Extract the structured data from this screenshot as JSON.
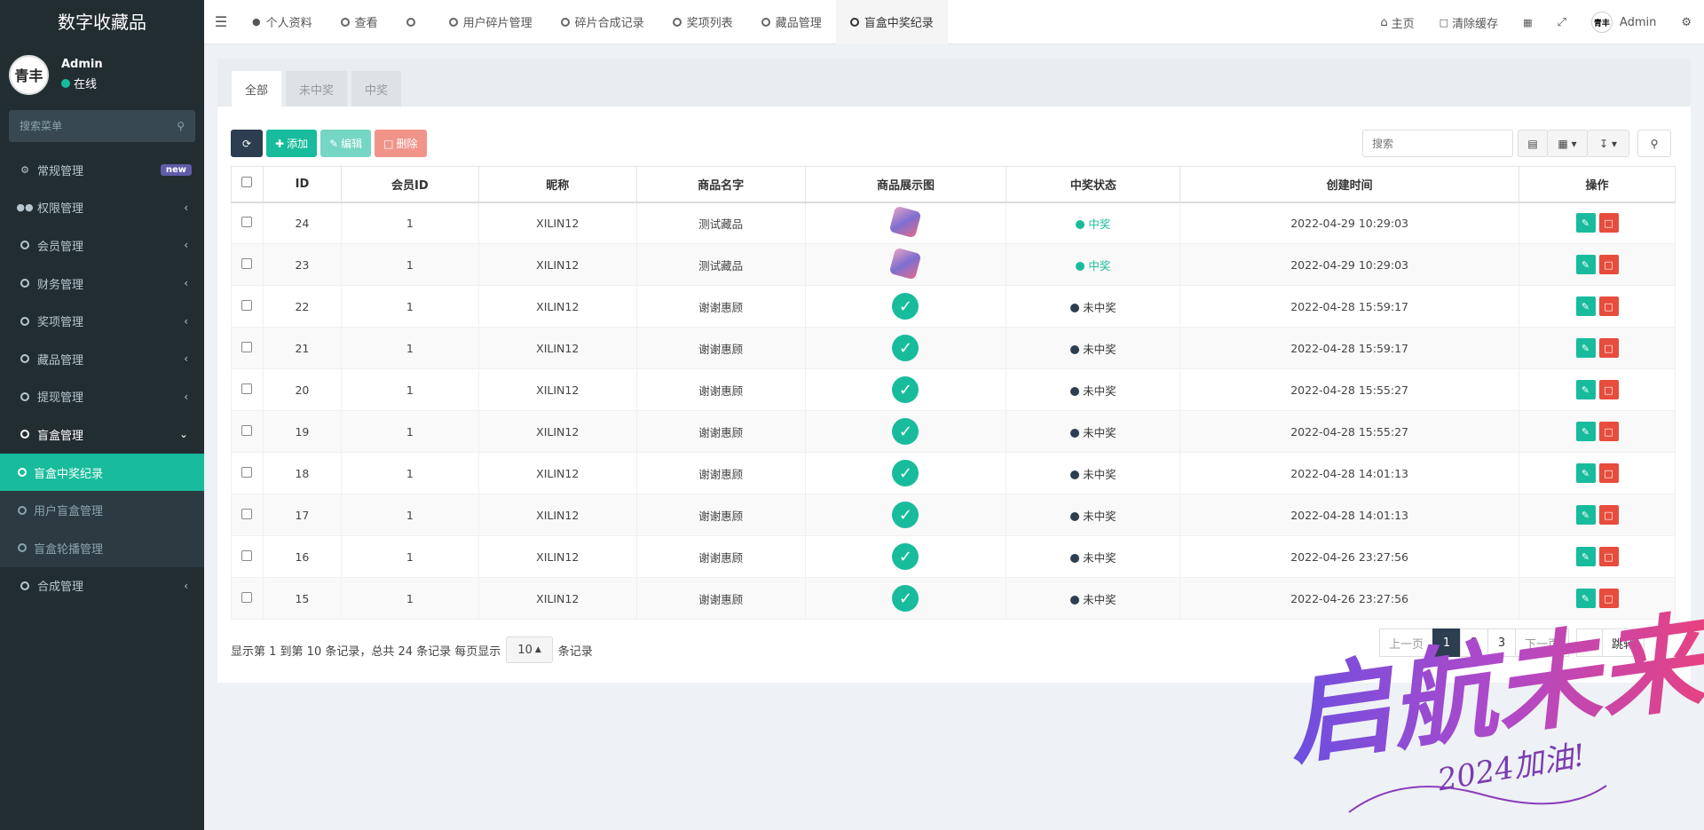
{
  "sidebar": {
    "brand": "数字收藏品",
    "user": {
      "name": "Admin",
      "status": "在线",
      "avatar_text": "青丰"
    },
    "search_placeholder": "搜索菜单",
    "items": [
      {
        "label": "常规管理",
        "icon": "cogs-icon",
        "badge": "new"
      },
      {
        "label": "权限管理",
        "icon": "users-icon"
      },
      {
        "label": "会员管理",
        "icon": "circle-icon"
      },
      {
        "label": "财务管理",
        "icon": "circle-icon"
      },
      {
        "label": "奖项管理",
        "icon": "circle-icon"
      },
      {
        "label": "藏品管理",
        "icon": "circle-icon"
      },
      {
        "label": "提现管理",
        "icon": "circle-icon"
      },
      {
        "label": "盲盒管理",
        "icon": "circle-icon",
        "open": true
      }
    ],
    "subitems": [
      {
        "label": "盲盒中奖纪录",
        "active": true
      },
      {
        "label": "用户盲盒管理"
      },
      {
        "label": "盲盒轮播管理"
      }
    ],
    "last_item": {
      "label": "合成管理"
    }
  },
  "topbar": {
    "tabs": [
      {
        "label": "个人资料",
        "icon": "user-icon"
      },
      {
        "label": "查看"
      },
      {
        "label": ""
      },
      {
        "label": "用户碎片管理"
      },
      {
        "label": "碎片合成记录"
      },
      {
        "label": "奖项列表"
      },
      {
        "label": "藏品管理"
      },
      {
        "label": "盲盒中奖纪录",
        "active": true
      }
    ],
    "right": {
      "home": "主页",
      "clear_cache": "清除缓存",
      "user": "Admin"
    }
  },
  "panel": {
    "tabs": [
      "全部",
      "未中奖",
      "中奖"
    ],
    "toolbar": {
      "add": "添加",
      "edit": "编辑",
      "delete": "删除"
    },
    "search_placeholder": "搜索"
  },
  "table": {
    "headers": [
      "ID",
      "会员ID",
      "昵称",
      "商品名字",
      "商品展示图",
      "中奖状态",
      "创建时间",
      "操作"
    ],
    "rows": [
      {
        "id": "24",
        "member_id": "1",
        "nickname": "XILIN12",
        "product": "测试藏品",
        "image": "gem",
        "status": "中奖",
        "win": true,
        "created": "2022-04-29 10:29:03"
      },
      {
        "id": "23",
        "member_id": "1",
        "nickname": "XILIN12",
        "product": "测试藏品",
        "image": "gem",
        "status": "中奖",
        "win": true,
        "created": "2022-04-29 10:29:03"
      },
      {
        "id": "22",
        "member_id": "1",
        "nickname": "XILIN12",
        "product": "谢谢惠顾",
        "image": "check",
        "status": "未中奖",
        "win": false,
        "created": "2022-04-28 15:59:17"
      },
      {
        "id": "21",
        "member_id": "1",
        "nickname": "XILIN12",
        "product": "谢谢惠顾",
        "image": "check",
        "status": "未中奖",
        "win": false,
        "created": "2022-04-28 15:59:17"
      },
      {
        "id": "20",
        "member_id": "1",
        "nickname": "XILIN12",
        "product": "谢谢惠顾",
        "image": "check",
        "status": "未中奖",
        "win": false,
        "created": "2022-04-28 15:55:27"
      },
      {
        "id": "19",
        "member_id": "1",
        "nickname": "XILIN12",
        "product": "谢谢惠顾",
        "image": "check",
        "status": "未中奖",
        "win": false,
        "created": "2022-04-28 15:55:27"
      },
      {
        "id": "18",
        "member_id": "1",
        "nickname": "XILIN12",
        "product": "谢谢惠顾",
        "image": "check",
        "status": "未中奖",
        "win": false,
        "created": "2022-04-28 14:01:13"
      },
      {
        "id": "17",
        "member_id": "1",
        "nickname": "XILIN12",
        "product": "谢谢惠顾",
        "image": "check",
        "status": "未中奖",
        "win": false,
        "created": "2022-04-28 14:01:13"
      },
      {
        "id": "16",
        "member_id": "1",
        "nickname": "XILIN12",
        "product": "谢谢惠顾",
        "image": "check",
        "status": "未中奖",
        "win": false,
        "created": "2022-04-26 23:27:56"
      },
      {
        "id": "15",
        "member_id": "1",
        "nickname": "XILIN12",
        "product": "谢谢惠顾",
        "image": "check",
        "status": "未中奖",
        "win": false,
        "created": "2022-04-26 23:27:56"
      }
    ]
  },
  "pager": {
    "info_prefix": "显示第 1 到第 10 条记录，总共 24 条记录 每页显示",
    "page_size": "10",
    "info_suffix": "条记录",
    "prev": "上一页",
    "pages": [
      "1",
      "2",
      "3"
    ],
    "next": "下一页",
    "jump": "跳转"
  },
  "watermark": {
    "main": "启航未来",
    "sub": "2024加油!"
  },
  "colors": {
    "accent": "#18bc9c",
    "sidebar": "#222d32",
    "danger": "#e74c3c",
    "dark": "#2c3e50"
  }
}
